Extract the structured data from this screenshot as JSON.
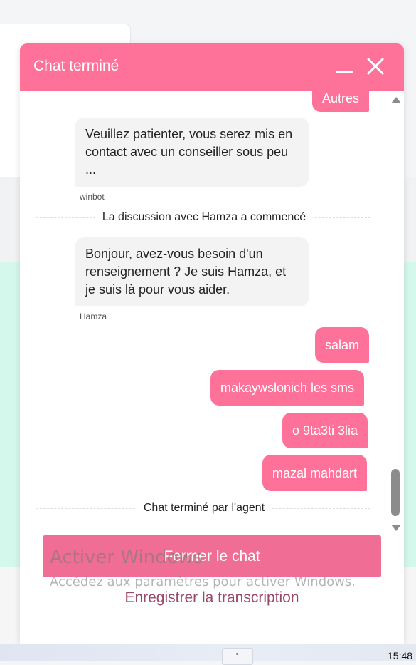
{
  "chat": {
    "title": "Chat terminé",
    "messages": {
      "top_partial": "Autres",
      "wait_msg": "Veuillez patienter, vous serez mis en contact avec un conseiller sous peu ...",
      "wait_sender": "winbot",
      "system_start": "La discussion avec Hamza a commencé",
      "greeting": "Bonjour, avez-vous besoin d'un renseignement ? Je suis Hamza, et je suis là pour vous aider.",
      "greeting_sender": "Hamza",
      "user_1": "salam",
      "user_2": "makaywslonich les sms",
      "user_3": "o 9ta3ti 3lia",
      "user_4": "mazal mahdart",
      "system_end": "Chat terminé par l'agent"
    },
    "end_button": "Fermer le chat",
    "transcript_link": "Enregistrer la transcription"
  },
  "watermark": {
    "title": "Activer Windows",
    "subtitle": "Accédez aux paramètres pour activer Windows."
  },
  "taskbar": {
    "clock": "15:48"
  },
  "colors": {
    "accent": "#fe7199",
    "button": "#f06e95",
    "link": "#99486a",
    "mint": "#d5f8ec"
  },
  "icons": {
    "minimize": "minimize-icon",
    "close": "close-icon"
  }
}
